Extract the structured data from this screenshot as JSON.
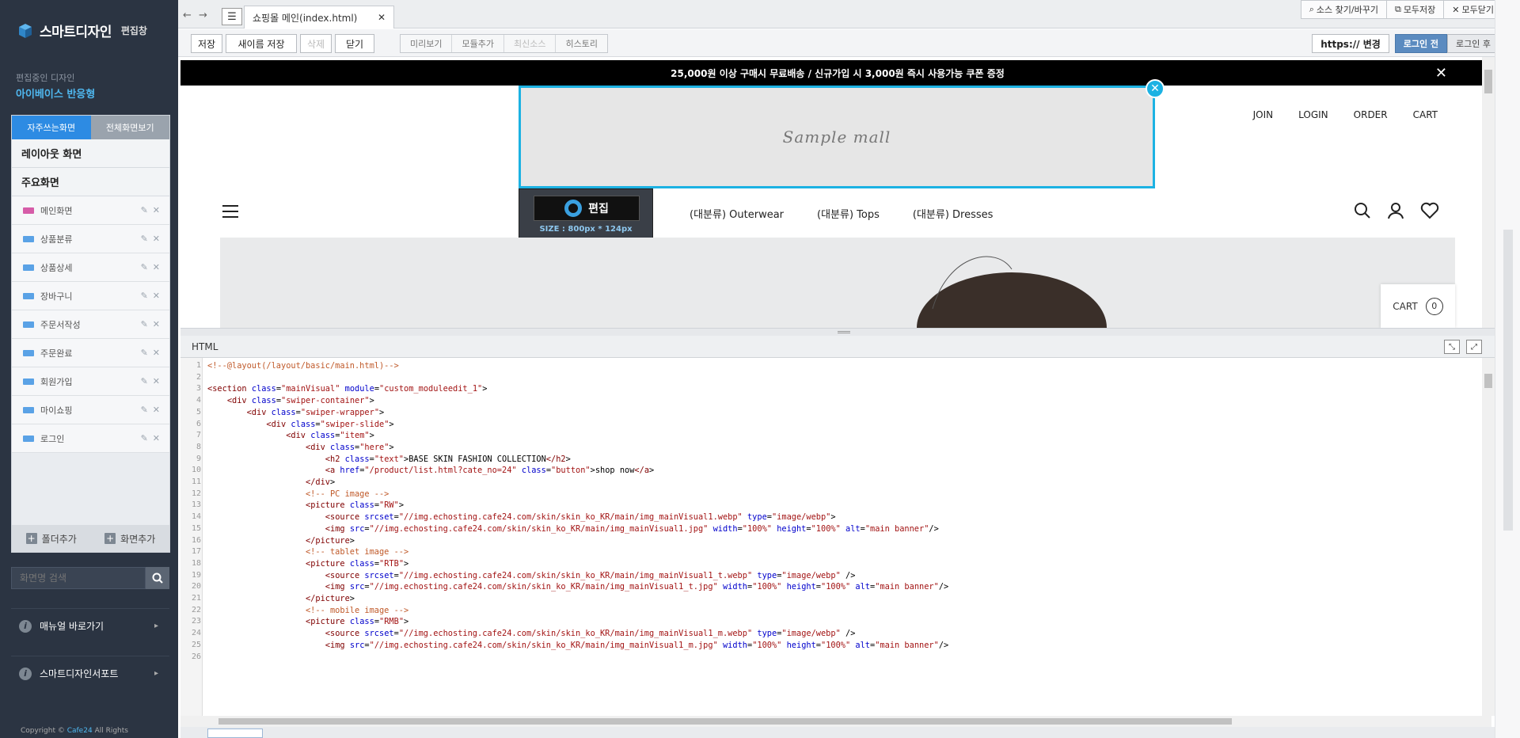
{
  "sidebar": {
    "app_title": "스마트디자인",
    "app_sub": "편집창",
    "current_label": "편집중인 디자인",
    "current_name": "아이베이스 반응형",
    "tabs": [
      "자주쓰는화면",
      "전체화면보기"
    ],
    "sections": {
      "layout": "레이아웃 화면",
      "main": "주요화면"
    },
    "items": [
      "메인화면",
      "상품분류",
      "상품상세",
      "장바구니",
      "주문서작성",
      "주문완료",
      "회원가입",
      "마이쇼핑",
      "로그인"
    ],
    "footer": {
      "add_folder": "폴더추가",
      "add_screen": "화면추가"
    },
    "search_placeholder": "화면명 검색",
    "links": [
      "매뉴얼 바로가기",
      "스마트디자인서포트"
    ],
    "copyright_prefix": "Copyright ©",
    "copyright_brand": "Cafe24",
    "copyright_suffix": "All Rights"
  },
  "topbar": {
    "file_tab": "쇼핑몰 메인(index.html)",
    "tools": [
      "소스 찾기/바꾸기",
      "모두저장",
      "모두닫기"
    ]
  },
  "toolbar": {
    "save": "저장",
    "save_as": "새이름 저장",
    "delete": "삭제",
    "close": "닫기",
    "group": [
      "미리보기",
      "모듈추가",
      "최신소스",
      "히스토리"
    ],
    "https": "https:// 변경",
    "login_before": "로그인 전",
    "login_after": "로그인 후"
  },
  "preview": {
    "banner": "25,000원 이상 구매시 무료배송 / 신규가입 시 3,000원 즉시 사용가능 쿠폰 증정",
    "logo_text": "Sample mall",
    "top_links": [
      "JOIN",
      "LOGIN",
      "ORDER",
      "CART"
    ],
    "edit_label": "편집",
    "size_label": "SIZE : 800px * 124px",
    "categories": [
      "(대분류) Outerwear",
      "(대분류) Tops",
      "(대분류) Dresses"
    ],
    "cart_label": "CART",
    "cart_count": "0"
  },
  "html_panel": {
    "title": "HTML",
    "line_numbers": [
      "1",
      "2",
      "3",
      "4",
      "5",
      "6",
      "7",
      "8",
      "9",
      "10",
      "11",
      "12",
      "13",
      "14",
      "15",
      "16",
      "17",
      "18",
      "19",
      "20",
      "21",
      "22",
      "23",
      "24",
      "25",
      "26"
    ],
    "lines": [
      "<!--@layout(/layout/basic/main.html)-->",
      "",
      "<section class=\"mainVisual\" module=\"custom_moduleedit_1\">",
      "    <div class=\"swiper-container\">",
      "        <div class=\"swiper-wrapper\">",
      "            <div class=\"swiper-slide\">",
      "                <div class=\"item\">",
      "                    <div class=\"here\">",
      "                        <h2 class=\"text\">BASE SKIN FASHION COLLECTION</h2>",
      "                        <a href=\"/product/list.html?cate_no=24\" class=\"button\">shop now</a>",
      "                    </div>",
      "                    <!-- PC image -->",
      "                    <picture class=\"RW\">",
      "                        <source srcset=\"//img.echosting.cafe24.com/skin/skin_ko_KR/main/img_mainVisual1.webp\" type=\"image/webp\">",
      "                        <img src=\"//img.echosting.cafe24.com/skin/skin_ko_KR/main/img_mainVisual1.jpg\" width=\"100%\" height=\"100%\" alt=\"main banner\"/>",
      "                    </picture>",
      "                    <!-- tablet image -->",
      "                    <picture class=\"RTB\">",
      "                        <source srcset=\"//img.echosting.cafe24.com/skin/skin_ko_KR/main/img_mainVisual1_t.webp\" type=\"image/webp\" />",
      "                        <img src=\"//img.echosting.cafe24.com/skin/skin_ko_KR/main/img_mainVisual1_t.jpg\" width=\"100%\" height=\"100%\" alt=\"main banner\"/>",
      "                    </picture>",
      "                    <!-- mobile image -->",
      "                    <picture class=\"RMB\">",
      "                        <source srcset=\"//img.echosting.cafe24.com/skin/skin_ko_KR/main/img_mainVisual1_m.webp\" type=\"image/webp\" />",
      "                        <img src=\"//img.echosting.cafe24.com/skin/skin_ko_KR/main/img_mainVisual1_m.jpg\" width=\"100%\" height=\"100%\" alt=\"main banner\"/>",
      ""
    ]
  },
  "colors": {
    "accent": "#1cb2e3",
    "sidebar_bg": "#2b3442",
    "tab_active": "#2d8be3"
  }
}
